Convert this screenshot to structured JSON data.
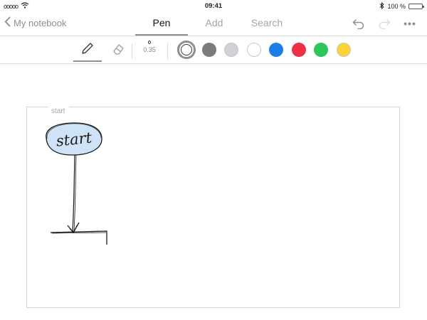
{
  "status_bar": {
    "carrier": "ooooo",
    "time": "09:41",
    "battery": "100 %",
    "battery_level": 1.0,
    "icons": [
      "wifi-icon",
      "bluetooth-icon",
      "battery-icon"
    ]
  },
  "nav": {
    "back_label": "My notebook",
    "tabs": [
      {
        "label": "Pen",
        "active": true
      },
      {
        "label": "Add",
        "active": false
      },
      {
        "label": "Search",
        "active": false
      }
    ],
    "right_icons": [
      "undo-icon",
      "redo-icon",
      "more-icon"
    ],
    "more_label": "•••"
  },
  "toolbar": {
    "tools": [
      {
        "name": "pen",
        "icon": "pen-icon",
        "selected": true
      },
      {
        "name": "eraser",
        "icon": "eraser-icon",
        "selected": false
      }
    ],
    "stroke_width": "0.35",
    "colors": [
      {
        "hex": "#ffffff",
        "selected": true
      },
      {
        "hex": "#7b7b7b",
        "selected": false
      },
      {
        "hex": "#d1d1d6",
        "selected": false
      },
      {
        "hex": "#ffffff",
        "selected": false
      },
      {
        "hex": "#1e7ee8",
        "selected": false
      },
      {
        "hex": "#ee2f45",
        "selected": false
      },
      {
        "hex": "#2dc65a",
        "selected": false
      },
      {
        "hex": "#fdd337",
        "selected": false
      }
    ]
  },
  "canvas": {
    "title": "start",
    "ink_color": "#1a1a1a",
    "bubble_fill": "#cfe3f6",
    "handwritten_text": "start"
  }
}
